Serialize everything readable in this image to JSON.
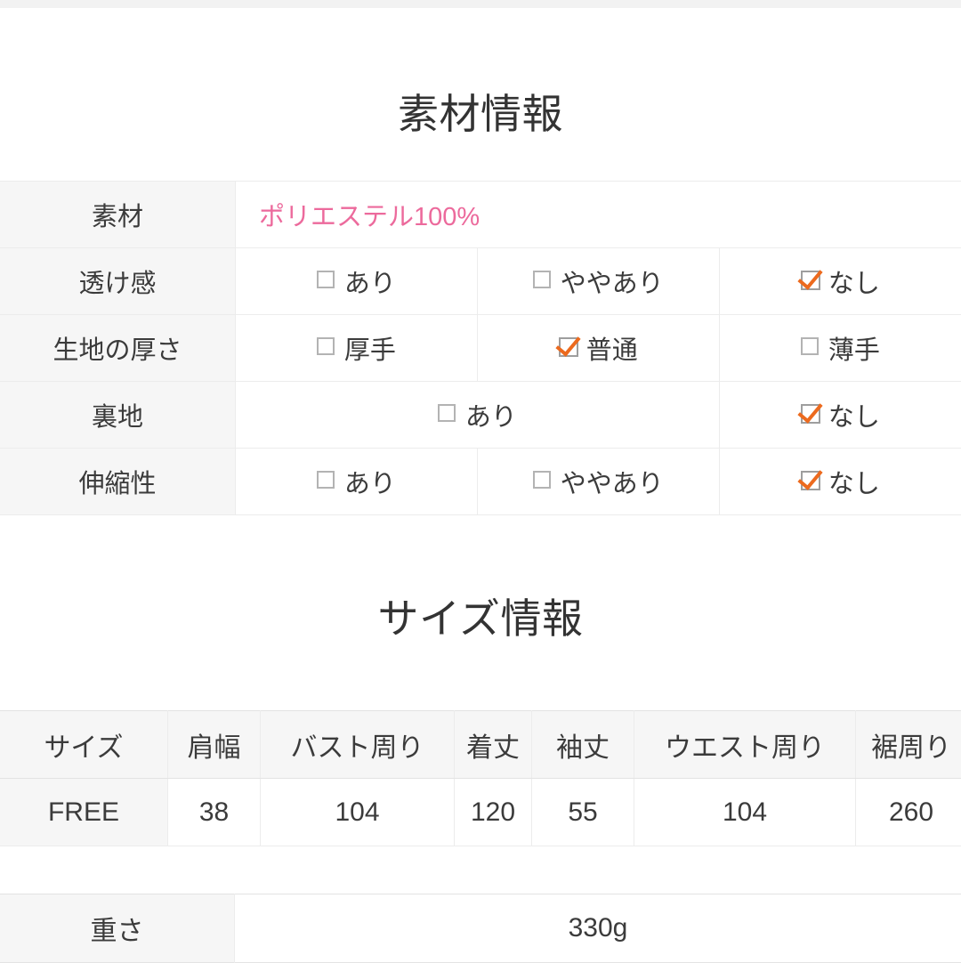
{
  "material_section": {
    "title": "素材情報",
    "rows": [
      {
        "label": "素材",
        "type": "value",
        "value": "ポリエステル100%",
        "value_color": "#ec6a9c"
      },
      {
        "label": "透け感",
        "type": "options",
        "options": [
          {
            "label": "あり",
            "checked": false
          },
          {
            "label": "ややあり",
            "checked": false
          },
          {
            "label": "なし",
            "checked": true
          }
        ]
      },
      {
        "label": "生地の厚さ",
        "type": "options",
        "options": [
          {
            "label": "厚手",
            "checked": false
          },
          {
            "label": "普通",
            "checked": true
          },
          {
            "label": "薄手",
            "checked": false
          }
        ]
      },
      {
        "label": "裏地",
        "type": "options",
        "options": [
          {
            "label": "あり",
            "checked": false
          },
          {
            "label": "なし",
            "checked": true
          }
        ]
      },
      {
        "label": "伸縮性",
        "type": "options",
        "options": [
          {
            "label": "あり",
            "checked": false
          },
          {
            "label": "ややあり",
            "checked": false
          },
          {
            "label": "なし",
            "checked": true
          }
        ]
      }
    ]
  },
  "size_section": {
    "title": "サイズ情報",
    "headers": [
      "サイズ",
      "肩幅",
      "バスト周り",
      "着丈",
      "袖丈",
      "ウエスト周り",
      "裾周り"
    ],
    "rows": [
      [
        "FREE",
        "38",
        "104",
        "120",
        "55",
        "104",
        "260"
      ]
    ]
  },
  "weight_section": {
    "label": "重さ",
    "value": "330g"
  },
  "colors": {
    "accent_pink": "#ec6a9c",
    "check_orange": "#ec6a1e",
    "header_gray": "#f6f6f6",
    "border_gray": "#ececec",
    "text_dark": "#3b3b3b"
  }
}
